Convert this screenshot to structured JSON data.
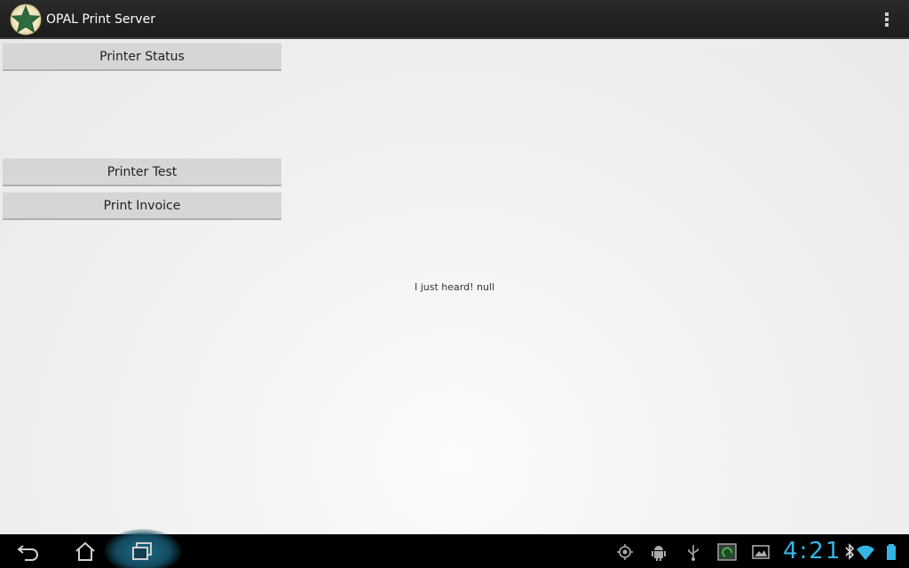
{
  "app": {
    "title": "OPAL Print Server",
    "icon": "green-star-icon",
    "overflow_icon": "overflow-menu-icon",
    "accent_color": "#2e6b3f"
  },
  "buttons": {
    "printer_status": "Printer Status",
    "printer_test": "Printer Test",
    "print_invoice": "Print Invoice"
  },
  "message": "I just heard! null",
  "system_bar": {
    "nav_icons": [
      "back-icon",
      "home-icon",
      "recent-apps-icon"
    ],
    "status_icons": [
      "gps-icon",
      "android-debug-icon",
      "usb-icon",
      "screenshot-icon",
      "gallery-icon",
      "bluetooth-icon",
      "wifi-icon",
      "battery-icon"
    ],
    "time": "4:21",
    "clock_color": "#35b5e5"
  }
}
